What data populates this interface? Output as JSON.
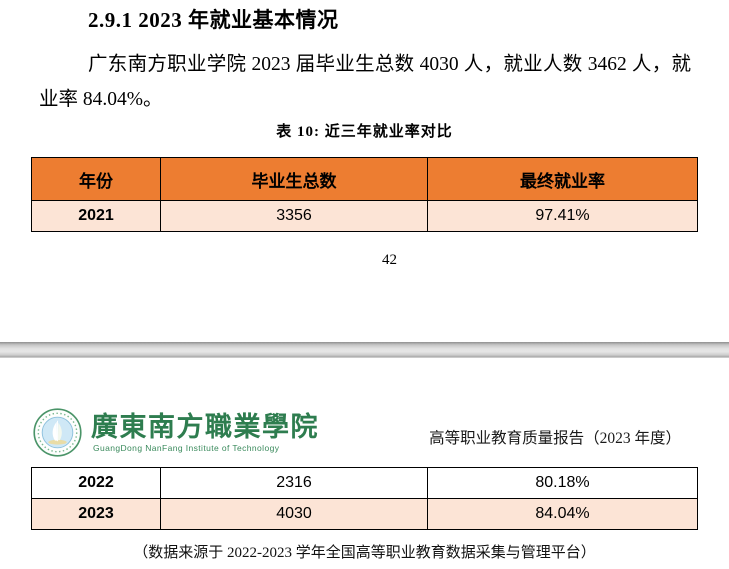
{
  "document": {
    "page1": {
      "heading": "2.9.1 2023 年就业基本情况",
      "paragraph": "广东南方职业学院 2023 届毕业生总数 4030 人，就业人数 3462 人，就业率 84.04%。",
      "table_caption": "表 10: 近三年就业率对比",
      "page_number": "42"
    },
    "page2": {
      "logo": {
        "name_zh": "廣東南方職業學院",
        "name_en": "GuangDong NanFang Institute of Technology"
      },
      "header_right": "高等职业教育质量报告（2023 年度）",
      "footer_note": "（数据来源于 2022-2023 学年全国高等职业教育数据采集与管理平台）"
    },
    "table": {
      "columns": [
        "年份",
        "毕业生总数",
        "最终就业率"
      ],
      "rows": [
        {
          "year": "2021",
          "graduates": "3356",
          "rate": "97.41%"
        },
        {
          "year": "2022",
          "graduates": "2316",
          "rate": "80.18%"
        },
        {
          "year": "2023",
          "graduates": "4030",
          "rate": "84.04%"
        }
      ]
    },
    "colors": {
      "table_header_bg": "#ED7D31",
      "table_row_highlight_bg": "#FCE4D6",
      "logo_green": "#2E7D4F"
    }
  }
}
